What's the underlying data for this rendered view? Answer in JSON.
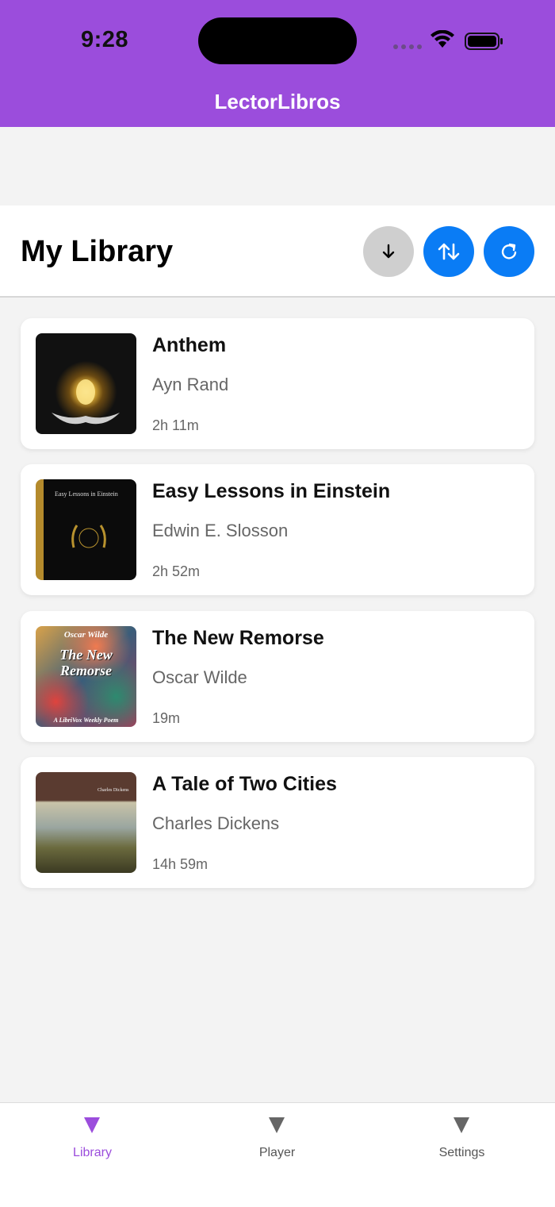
{
  "status_bar": {
    "time": "9:28"
  },
  "header": {
    "title": "LectorLibros"
  },
  "library": {
    "title": "My Library",
    "buttons": [
      {
        "name": "download",
        "icon": "arrow-down-icon",
        "color": "#cfcfcf"
      },
      {
        "name": "sort",
        "icon": "sort-arrows-icon",
        "color": "#0a7cf5"
      },
      {
        "name": "refresh",
        "icon": "refresh-icon",
        "color": "#0a7cf5"
      }
    ]
  },
  "books": [
    {
      "title": "Anthem",
      "author": "Ayn Rand",
      "duration": "2h 11m"
    },
    {
      "title": "Easy Lessons in Einstein",
      "author": "Edwin E. Slosson",
      "duration": "2h 52m",
      "cover_text": "Easy Lessons in Einstein"
    },
    {
      "title": "The New Remorse",
      "author": "Oscar Wilde",
      "duration": "19m",
      "cover_text": {
        "author": "Oscar Wilde",
        "title": "The New Remorse",
        "footer": "A LibriVox Weekly Poem"
      }
    },
    {
      "title": "A Tale of Two Cities",
      "author": "Charles Dickens",
      "duration": "14h 59m",
      "cover_text": "Charles Dickens"
    }
  ],
  "tabs": [
    {
      "label": "Library",
      "active": true
    },
    {
      "label": "Player",
      "active": false
    },
    {
      "label": "Settings",
      "active": false
    }
  ],
  "colors": {
    "accent": "#9b4ddc",
    "primary_button": "#0a7cf5",
    "muted_button": "#cfcfcf"
  }
}
